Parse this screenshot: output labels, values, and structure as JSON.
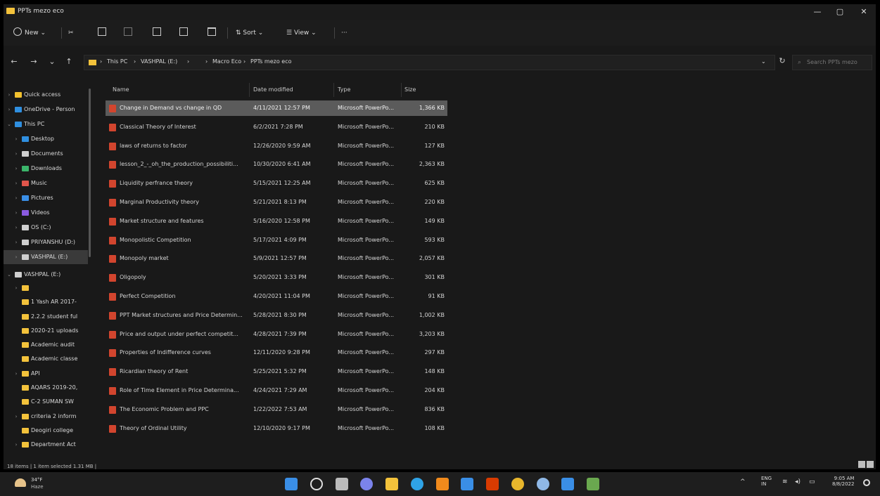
{
  "window": {
    "title": "PPTs mezo eco",
    "minimize": "—",
    "maximize": "▢",
    "close": "✕"
  },
  "toolbar": {
    "new_label": "New",
    "sort_label": "Sort",
    "view_label": "View",
    "more_label": "···"
  },
  "address": {
    "crumbs": [
      "This PC",
      "VASHPAL (E:)",
      "Macro Eco",
      "PPTs mezo eco"
    ],
    "search_placeholder": "Search PPTs mezo"
  },
  "sidebar": {
    "items": [
      {
        "label": "Quick access",
        "color": "#f2c12e"
      },
      {
        "label": "OneDrive - Person",
        "color": "#2f8fe0"
      },
      {
        "label": "This PC",
        "color": "#2f8fe0"
      },
      {
        "label": "Desktop",
        "color": "#2f8fe0"
      },
      {
        "label": "Documents",
        "color": "#cfcfcf"
      },
      {
        "label": "Downloads",
        "color": "#3bb56a"
      },
      {
        "label": "Music",
        "color": "#e0554b"
      },
      {
        "label": "Pictures",
        "color": "#3a8ee6"
      },
      {
        "label": "Videos",
        "color": "#8a5ae0"
      },
      {
        "label": "OS (C:)",
        "color": "#cfcfcf"
      },
      {
        "label": "PRIYANSHU (D:)",
        "color": "#cfcfcf"
      },
      {
        "label": "VASHPAL (E:)",
        "color": "#cfcfcf"
      },
      {
        "label": "VASHPAL (E:)",
        "color": "#cfcfcf"
      },
      {
        "label": "",
        "color": "#f3c23b"
      },
      {
        "label": "1 Yash AR 2017-",
        "color": "#f3c23b"
      },
      {
        "label": "2.2.2 student ful",
        "color": "#f3c23b"
      },
      {
        "label": "2020-21 uploads",
        "color": "#f3c23b"
      },
      {
        "label": "Academic audit",
        "color": "#f3c23b"
      },
      {
        "label": "Academic classe",
        "color": "#f3c23b"
      },
      {
        "label": "API",
        "color": "#f3c23b"
      },
      {
        "label": "AQARS 2019-20,",
        "color": "#f3c23b"
      },
      {
        "label": "C-2 SUMAN SW",
        "color": "#f3c23b"
      },
      {
        "label": "criteria 2 inform",
        "color": "#f3c23b"
      },
      {
        "label": "Deogiri college",
        "color": "#f3c23b"
      },
      {
        "label": "Department Act",
        "color": "#f3c23b"
      }
    ]
  },
  "columns": {
    "name": "Name",
    "date": "Date modified",
    "type": "Type",
    "size": "Size"
  },
  "files": [
    {
      "name": "Change in Demand vs change in QD",
      "date": "4/11/2021 12:57 PM",
      "type": "Microsoft PowerPo...",
      "size": "1,366 KB"
    },
    {
      "name": "Classical Theory of Interest",
      "date": "6/2/2021 7:28 PM",
      "type": "Microsoft PowerPo...",
      "size": "210 KB"
    },
    {
      "name": "laws of returns to factor",
      "date": "12/26/2020 9:59 AM",
      "type": "Microsoft PowerPo...",
      "size": "127 KB"
    },
    {
      "name": "lesson_2_-_oh_the_production_possibiliti...",
      "date": "10/30/2020 6:41 AM",
      "type": "Microsoft PowerPo...",
      "size": "2,363 KB"
    },
    {
      "name": "Liquidity perfrance theory",
      "date": "5/15/2021 12:25 AM",
      "type": "Microsoft PowerPo...",
      "size": "625 KB"
    },
    {
      "name": "Marginal Productivity theory",
      "date": "5/21/2021 8:13 PM",
      "type": "Microsoft PowerPo...",
      "size": "220 KB"
    },
    {
      "name": "Market structure and features",
      "date": "5/16/2020 12:58 PM",
      "type": "Microsoft PowerPo...",
      "size": "149 KB"
    },
    {
      "name": "Monopolistic Competition",
      "date": "5/17/2021 4:09 PM",
      "type": "Microsoft PowerPo...",
      "size": "593 KB"
    },
    {
      "name": "Monopoly market",
      "date": "5/9/2021 12:57 PM",
      "type": "Microsoft PowerPo...",
      "size": "2,057 KB"
    },
    {
      "name": "Oligopoly",
      "date": "5/20/2021 3:33 PM",
      "type": "Microsoft PowerPo...",
      "size": "301 KB"
    },
    {
      "name": "Perfect Competition",
      "date": "4/20/2021 11:04 PM",
      "type": "Microsoft PowerPo...",
      "size": "91 KB"
    },
    {
      "name": "PPT Market structures and Price Determin...",
      "date": "5/28/2021 8:30 PM",
      "type": "Microsoft PowerPo...",
      "size": "1,002 KB"
    },
    {
      "name": "Price and output under perfect competit...",
      "date": "4/28/2021 7:39 PM",
      "type": "Microsoft PowerPo...",
      "size": "3,203 KB"
    },
    {
      "name": "Properties of Indifference curves",
      "date": "12/11/2020 9:28 PM",
      "type": "Microsoft PowerPo...",
      "size": "297 KB"
    },
    {
      "name": "Ricardian theory of Rent",
      "date": "5/25/2021 5:32 PM",
      "type": "Microsoft PowerPo...",
      "size": "148 KB"
    },
    {
      "name": "Role of Time Element in Price Determina...",
      "date": "4/24/2021 7:29 AM",
      "type": "Microsoft PowerPo...",
      "size": "204 KB"
    },
    {
      "name": "The Economic Problem and PPC",
      "date": "1/22/2022 7:53 AM",
      "type": "Microsoft PowerPo...",
      "size": "836 KB"
    },
    {
      "name": "Theory of Ordinal Utility",
      "date": "12/10/2020 9:17 PM",
      "type": "Microsoft PowerPo...",
      "size": "108 KB"
    }
  ],
  "status": {
    "text": "18 items  |  1 item selected  1.31 MB  |"
  },
  "taskbar": {
    "temp": "34°F",
    "weather": "Haze",
    "lang1": "ENG",
    "lang2": "IN",
    "time": "9:05 AM",
    "date": "8/8/2022",
    "icons": [
      {
        "name": "start",
        "color": "#3a8ee6"
      },
      {
        "name": "search",
        "color": "#dddddd"
      },
      {
        "name": "task-view",
        "color": "#bbbbbb"
      },
      {
        "name": "chat",
        "color": "#7b83eb"
      },
      {
        "name": "file-explorer",
        "color": "#f3c23b"
      },
      {
        "name": "edge",
        "color": "#2fa3e6"
      },
      {
        "name": "vlc",
        "color": "#f08a1c"
      },
      {
        "name": "store",
        "color": "#3a8ee6"
      },
      {
        "name": "office",
        "color": "#d83b01"
      },
      {
        "name": "chrome",
        "color": "#e8b62c"
      },
      {
        "name": "network",
        "color": "#8fb8e6"
      },
      {
        "name": "mail",
        "color": "#3a8ee6"
      },
      {
        "name": "extra-app",
        "color": "#6aa84f"
      }
    ]
  }
}
